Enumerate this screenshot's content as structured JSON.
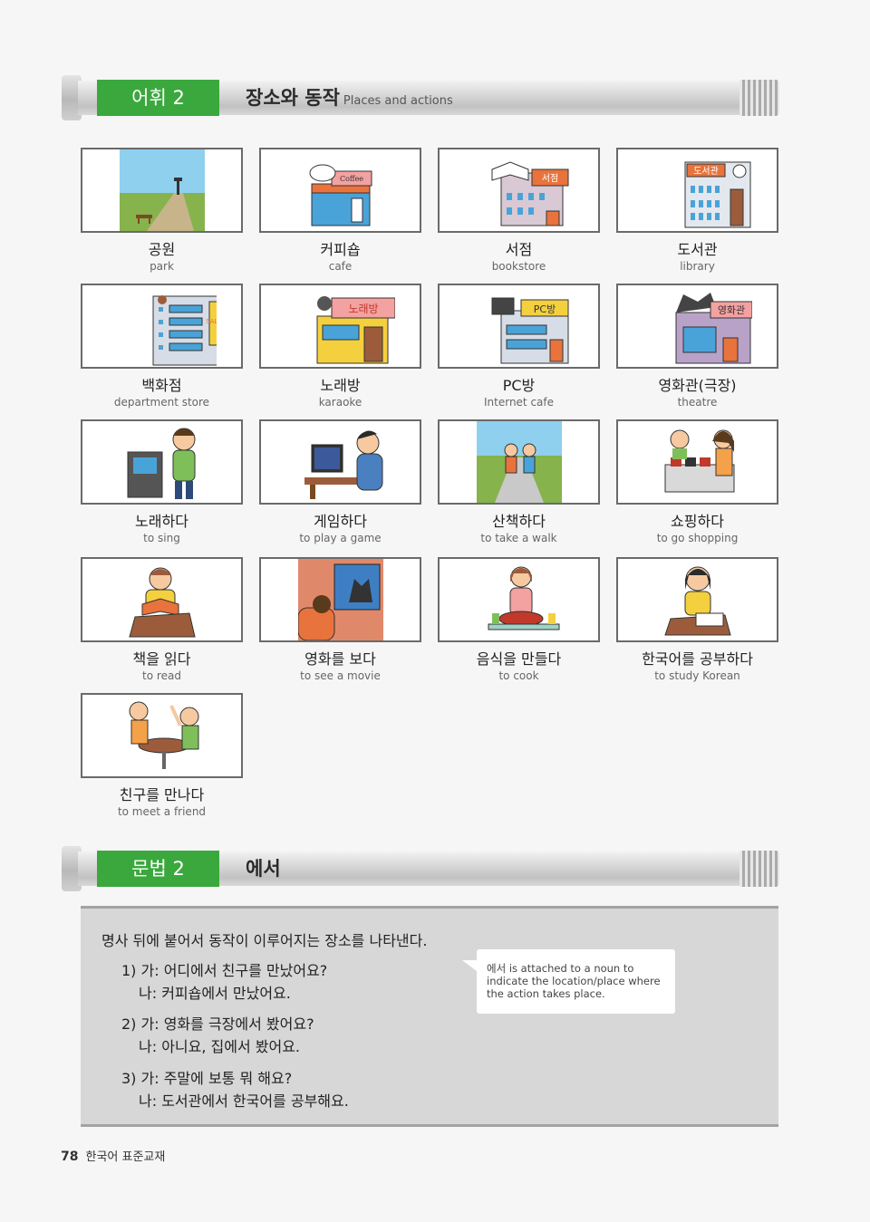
{
  "vocab_header": {
    "tag": "어휘 2",
    "title": "장소와 동작",
    "subtitle": "Places and actions"
  },
  "vocab": [
    {
      "ko": "공원",
      "en": "park"
    },
    {
      "ko": "커피숍",
      "en": "cafe"
    },
    {
      "ko": "서점",
      "en": "bookstore"
    },
    {
      "ko": "도서관",
      "en": "library"
    },
    {
      "ko": "백화점",
      "en": "department store"
    },
    {
      "ko": "노래방",
      "en": "karaoke"
    },
    {
      "ko": "PC방",
      "en": "Internet cafe"
    },
    {
      "ko": "영화관(극장)",
      "en": "theatre"
    },
    {
      "ko": "노래하다",
      "en": "to sing"
    },
    {
      "ko": "게임하다",
      "en": "to play a game"
    },
    {
      "ko": "산책하다",
      "en": "to take a walk"
    },
    {
      "ko": "쇼핑하다",
      "en": "to go shopping"
    },
    {
      "ko": "책을 읽다",
      "en": "to read"
    },
    {
      "ko": "영화를 보다",
      "en": "to see a movie"
    },
    {
      "ko": "음식을 만들다",
      "en": "to cook"
    },
    {
      "ko": "한국어를 공부하다",
      "en": "to study Korean"
    },
    {
      "ko": "친구를 만나다",
      "en": "to meet a friend"
    }
  ],
  "illustration_labels": {
    "cafe_sign": "Coffee",
    "bookstore_sign": "서점",
    "library_sign": "도서관",
    "department_sign": "SALE",
    "karaoke_sign": "노래방",
    "pc_sign": "PC방",
    "theatre_sign": "영화관"
  },
  "grammar_header": {
    "tag": "문법 2",
    "title": "에서"
  },
  "grammar": {
    "intro": "명사 뒤에 붙어서 동작이 이루어지는 장소를 나타낸다.",
    "examples": [
      {
        "a": "1) 가: 어디에서 친구를 만났어요?",
        "b": "나: 커피숍에서 만났어요."
      },
      {
        "a": "2) 가: 영화를 극장에서 봤어요?",
        "b": "나: 아니요, 집에서 봤어요."
      },
      {
        "a": "3) 가: 주말에 보통 뭐 해요?",
        "b": "나: 도서관에서 한국어를 공부해요."
      }
    ],
    "note": "에서 is attached to a noun to indicate the location/place where the action takes place."
  },
  "footer": {
    "page": "78",
    "book": "한국어 표준교재"
  },
  "colors": {
    "tag_green": "#3ba83e",
    "panel_gray": "#d7d7d7",
    "border": "#6a6a6a"
  }
}
